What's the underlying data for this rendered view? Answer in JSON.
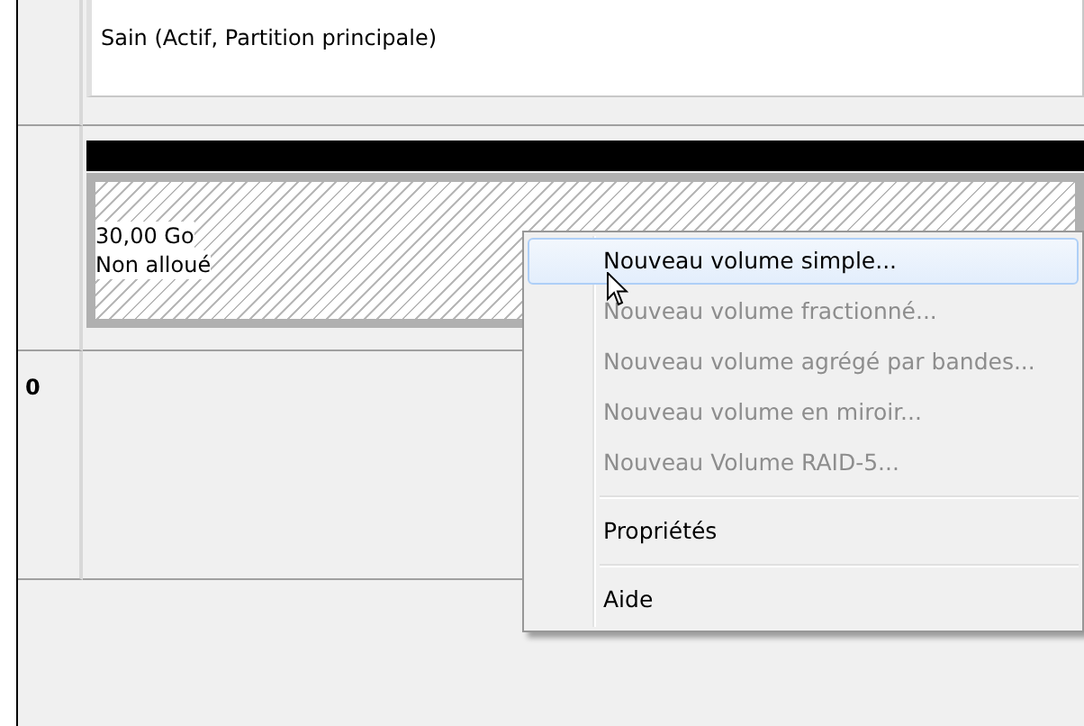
{
  "partition": {
    "status": "Sain (Actif, Partition principale)"
  },
  "unallocated": {
    "size": "30,00 Go",
    "label": "Non alloué",
    "selected": true
  },
  "disk_row": {
    "number": "0"
  },
  "context_menu": {
    "groups": [
      [
        {
          "label": "Nouveau volume simple...",
          "disabled": false,
          "selected": true
        },
        {
          "label": "Nouveau volume fractionné...",
          "disabled": true,
          "selected": false
        },
        {
          "label": "Nouveau volume agrégé par bandes...",
          "disabled": true,
          "selected": false
        },
        {
          "label": "Nouveau volume en miroir...",
          "disabled": true,
          "selected": false
        },
        {
          "label": "Nouveau Volume RAID-5...",
          "disabled": true,
          "selected": false
        }
      ],
      [
        {
          "label": "Propriétés",
          "disabled": false,
          "selected": false
        }
      ],
      [
        {
          "label": "Aide",
          "disabled": false,
          "selected": false
        }
      ]
    ]
  }
}
